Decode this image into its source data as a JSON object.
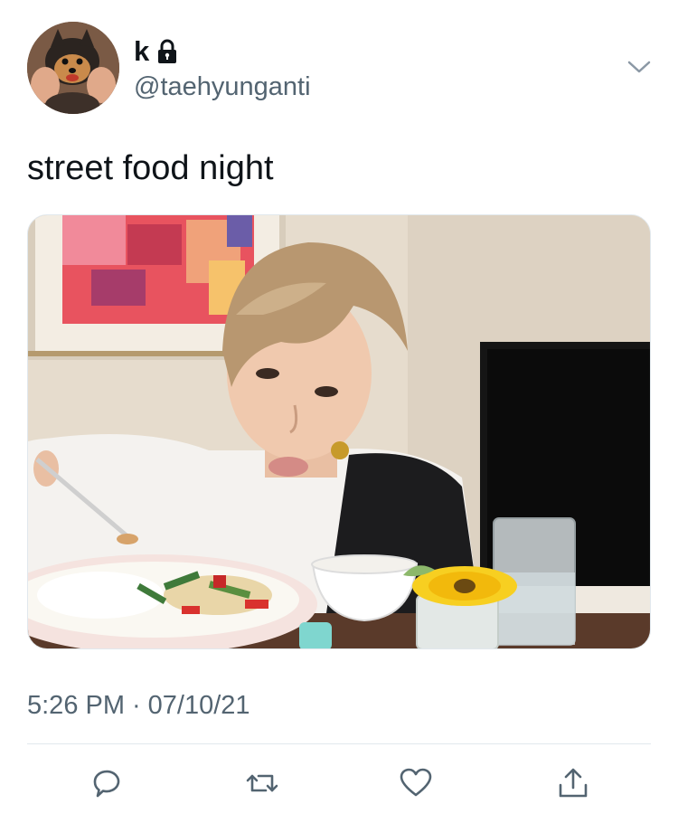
{
  "header": {
    "display_name": "k",
    "handle": "@taehyunganti",
    "locked_icon": "lock-icon",
    "menu_icon": "chevron-down-icon"
  },
  "tweet": {
    "text": "street food night",
    "time": "5:26 PM",
    "separator": "·",
    "date": "07/10/21"
  },
  "actions": [
    {
      "name": "reply",
      "icon": "reply-icon"
    },
    {
      "name": "retweet",
      "icon": "retweet-icon"
    },
    {
      "name": "like",
      "icon": "heart-icon"
    },
    {
      "name": "share",
      "icon": "share-icon"
    }
  ],
  "colors": {
    "text_primary": "#0f1419",
    "text_secondary": "#536471",
    "divider": "#e1e8ed",
    "icon": "#536471"
  }
}
